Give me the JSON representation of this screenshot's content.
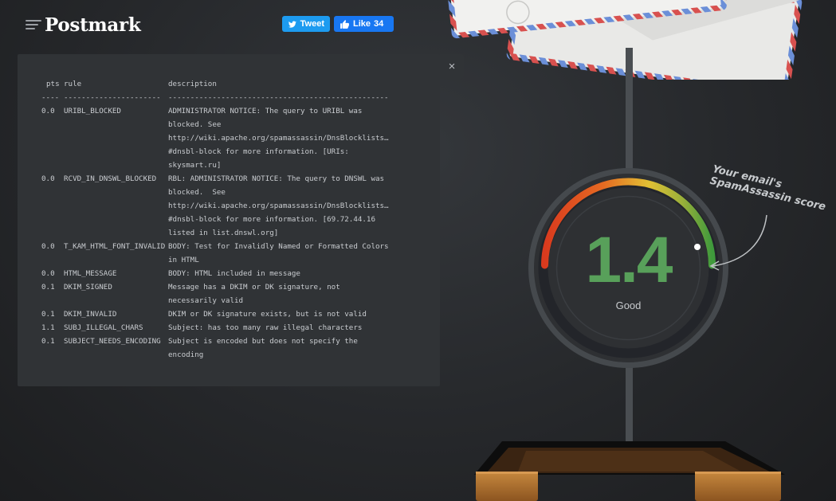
{
  "brand": {
    "logo_text": "Postmark"
  },
  "share": {
    "tweet_label": "Tweet",
    "like_label": "Like",
    "like_count": "34"
  },
  "report": {
    "close_glyph": "×",
    "header": {
      "pts": "pts",
      "rule": "rule",
      "description": "description"
    },
    "separator": {
      "pts": "----",
      "rule": "----------------------",
      "description": "--------------------------------------------------"
    },
    "rows": [
      {
        "pts": "0.0",
        "rule": "URIBL_BLOCKED",
        "lines": [
          "ADMINISTRATOR NOTICE: The query to URIBL was",
          "blocked. See",
          "http://wiki.apache.org/spamassassin/DnsBlocklists…",
          "#dnsbl-block for more information. [URIs:",
          "skysmart.ru]"
        ]
      },
      {
        "pts": "0.0",
        "rule": "RCVD_IN_DNSWL_BLOCKED",
        "lines": [
          "RBL: ADMINISTRATOR NOTICE: The query to DNSWL was",
          "blocked.  See",
          "http://wiki.apache.org/spamassassin/DnsBlocklists…",
          "#dnsbl-block for more information. [69.72.44.16",
          "listed in list.dnswl.org]"
        ]
      },
      {
        "pts": "0.0",
        "rule": "T_KAM_HTML_FONT_INVALID",
        "lines": [
          "BODY: Test for Invalidly Named or Formatted Colors",
          "in HTML"
        ]
      },
      {
        "pts": "0.0",
        "rule": "HTML_MESSAGE",
        "lines": [
          "BODY: HTML included in message"
        ]
      },
      {
        "pts": "0.1",
        "rule": "DKIM_SIGNED",
        "lines": [
          "Message has a DKIM or DK signature, not",
          "necessarily valid"
        ]
      },
      {
        "pts": "0.1",
        "rule": "DKIM_INVALID",
        "lines": [
          "DKIM or DK signature exists, but is not valid"
        ]
      },
      {
        "pts": "1.1",
        "rule": "SUBJ_ILLEGAL_CHARS",
        "lines": [
          "Subject: has too many raw illegal characters"
        ]
      },
      {
        "pts": "0.1",
        "rule": "SUBJECT_NEEDS_ENCODING",
        "lines": [
          "Subject is encoded but does not specify the",
          "encoding"
        ]
      }
    ]
  },
  "gauge": {
    "score": "1.4",
    "label": "Good",
    "score_color": "#58a05a",
    "annotation": [
      "Your email's",
      "SpamAssassin score"
    ]
  },
  "colors": {
    "background": "#2b2d30",
    "panel": "#303336",
    "tweet": "#1d9bf0",
    "like": "#1877f2",
    "gauge_red": "#d93a1e",
    "gauge_yellow": "#e2c034",
    "gauge_green": "#3f9a3c"
  },
  "icons": [
    "twitter-bird-icon",
    "thumbs-up-icon",
    "close-icon",
    "envelope-icon",
    "inbox-tray-icon"
  ]
}
